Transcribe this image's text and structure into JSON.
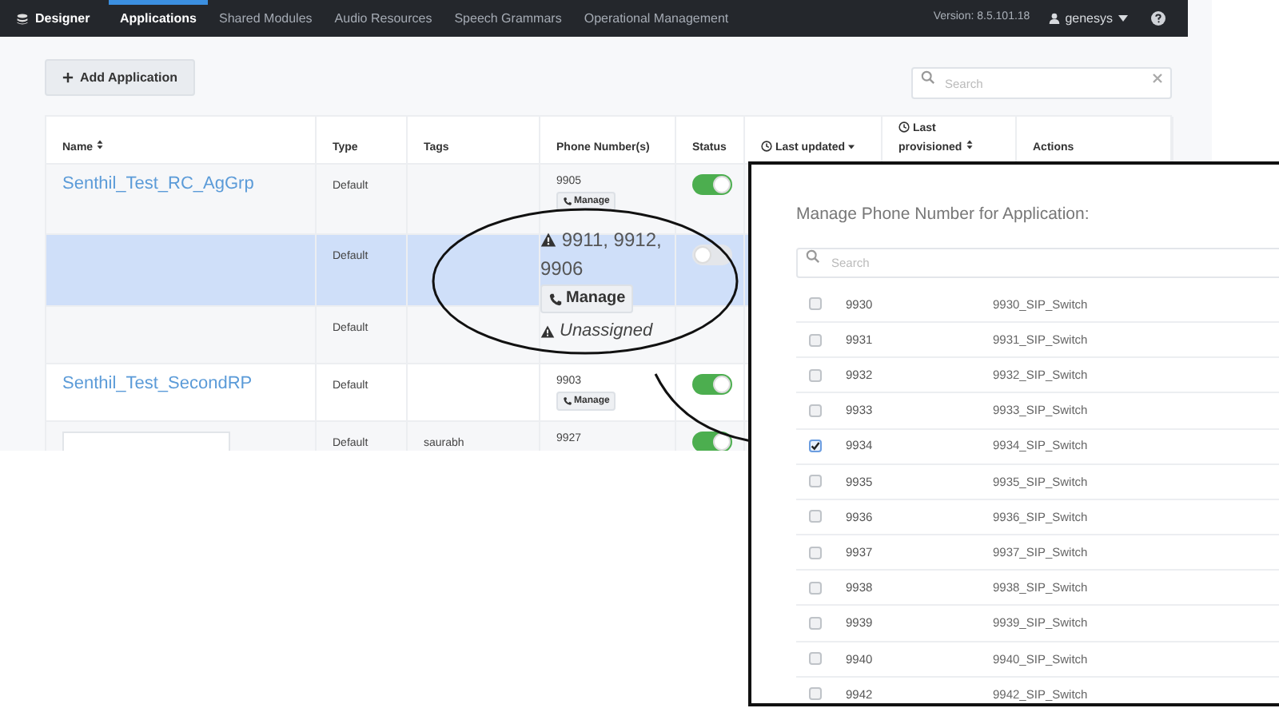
{
  "nav": {
    "brand": "Designer",
    "tabs": [
      {
        "label": "Applications",
        "selected": true
      },
      {
        "label": "Shared Modules",
        "selected": false
      },
      {
        "label": "Audio Resources",
        "selected": false
      },
      {
        "label": "Speech Grammars",
        "selected": false
      },
      {
        "label": "Operational Management",
        "selected": false
      }
    ],
    "version": "Version: 8.5.101.18",
    "user": "genesys"
  },
  "toolbar": {
    "add_button": "Add Application",
    "search": {
      "placeholder": "Search"
    }
  },
  "table": {
    "columns": [
      {
        "label": "Name",
        "sortable": true
      },
      {
        "label": "Type"
      },
      {
        "label": "Tags"
      },
      {
        "label": "Phone Number(s)"
      },
      {
        "label": "Status"
      },
      {
        "label": "Last updated",
        "sorted_descending": true,
        "clock": true
      },
      {
        "label": "Last provisioned",
        "sortable": true,
        "clock": true
      },
      {
        "label": "Actions"
      }
    ],
    "rows": [
      {
        "name": "Senthil_Test_RC_AgGrp",
        "type": "Default",
        "phone": {
          "kind": "normal",
          "numbers": "9905",
          "manage": "Manage"
        },
        "status_on": true,
        "selected": false
      },
      {
        "type": "Default",
        "phone": {
          "kind": "warning",
          "numbers": "9911, 9912, 9906",
          "manage": "Manage"
        },
        "status_on": false,
        "selected": true
      },
      {
        "type": "Default",
        "phone": {
          "kind": "unassigned",
          "numbers": "Unassigned"
        },
        "selected": false
      },
      {
        "name": "Senthil_Test_SecondRP",
        "type": "Default",
        "phone": {
          "kind": "normal",
          "numbers": "9903",
          "manage": "Manage"
        },
        "status_on": true,
        "selected": false
      },
      {
        "redacted": true,
        "type": "Default",
        "tags": "saurabh",
        "phone": {
          "kind": "normal",
          "numbers": "9927"
        },
        "status_on": true,
        "selected": false
      }
    ]
  },
  "popup": {
    "title": "Manage Phone Number for Application:",
    "search": {
      "placeholder": "Search"
    },
    "items": [
      {
        "number": "9930",
        "name": "9930_SIP_Switch",
        "checked": false
      },
      {
        "number": "9931",
        "name": "9931_SIP_Switch",
        "checked": false
      },
      {
        "number": "9932",
        "name": "9932_SIP_Switch",
        "checked": false
      },
      {
        "number": "9933",
        "name": "9933_SIP_Switch",
        "checked": false
      },
      {
        "number": "9934",
        "name": "9934_SIP_Switch",
        "checked": true
      },
      {
        "number": "9935",
        "name": "9935_SIP_Switch",
        "checked": false
      },
      {
        "number": "9936",
        "name": "9936_SIP_Switch",
        "checked": false
      },
      {
        "number": "9937",
        "name": "9937_SIP_Switch",
        "checked": false
      },
      {
        "number": "9938",
        "name": "9938_SIP_Switch",
        "checked": false
      },
      {
        "number": "9939",
        "name": "9939_SIP_Switch",
        "checked": false
      },
      {
        "number": "9940",
        "name": "9940_SIP_Switch",
        "checked": false
      },
      {
        "number": "9942",
        "name": "9942_SIP_Switch",
        "checked": false
      }
    ]
  }
}
